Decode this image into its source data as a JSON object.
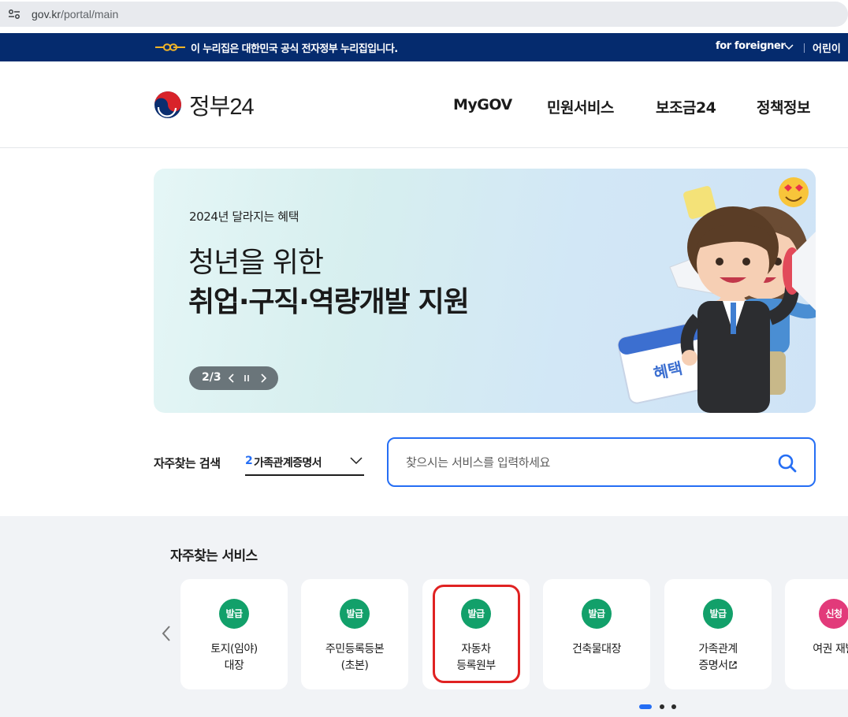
{
  "browser": {
    "url_domain": "gov.kr",
    "url_path": "/portal/main"
  },
  "gov_banner": {
    "text": "이 누리집은 대한민국 공식 전자정부 누리집입니다.",
    "for_foreigner": "for foreigner",
    "kids": "어린이"
  },
  "header": {
    "logo_text": "정부24",
    "nav": [
      "MyGOV",
      "민원서비스",
      "보조금24",
      "정책정보"
    ]
  },
  "hero": {
    "subtitle": "2024년 달라지는 혜택",
    "title_line1": "청년을 위한",
    "title_line2": "취업·구직·역량개발 지원",
    "counter": "2/3",
    "calendar_label": "혜택"
  },
  "search": {
    "label": "자주찾는 검색",
    "selected_rank": "2",
    "selected_text": "가족관계증명서",
    "placeholder": "찾으시는 서비스를 입력하세요"
  },
  "services": {
    "title": "자주찾는 서비스",
    "cards": [
      {
        "badge": "발급",
        "line1": "토지(임야)",
        "line2": "대장"
      },
      {
        "badge": "발급",
        "line1": "주민등록등본",
        "line2": "(초본)"
      },
      {
        "badge": "발급",
        "line1": "자동차",
        "line2": "등록원부"
      },
      {
        "badge": "발급",
        "line1": "건축물대장",
        "line2": ""
      },
      {
        "badge": "발급",
        "line1": "가족관계",
        "line2": "증명서"
      },
      {
        "badge": "신청",
        "line1": "여권 재발",
        "line2": ""
      }
    ],
    "pagination": {
      "total": 3,
      "current": 1
    }
  },
  "colors": {
    "banner_bg": "#052b6e",
    "accent_blue": "#256ef4",
    "issue_green": "#12a06a",
    "apply_pink": "#e23a7a",
    "highlight_red": "#e02222"
  }
}
